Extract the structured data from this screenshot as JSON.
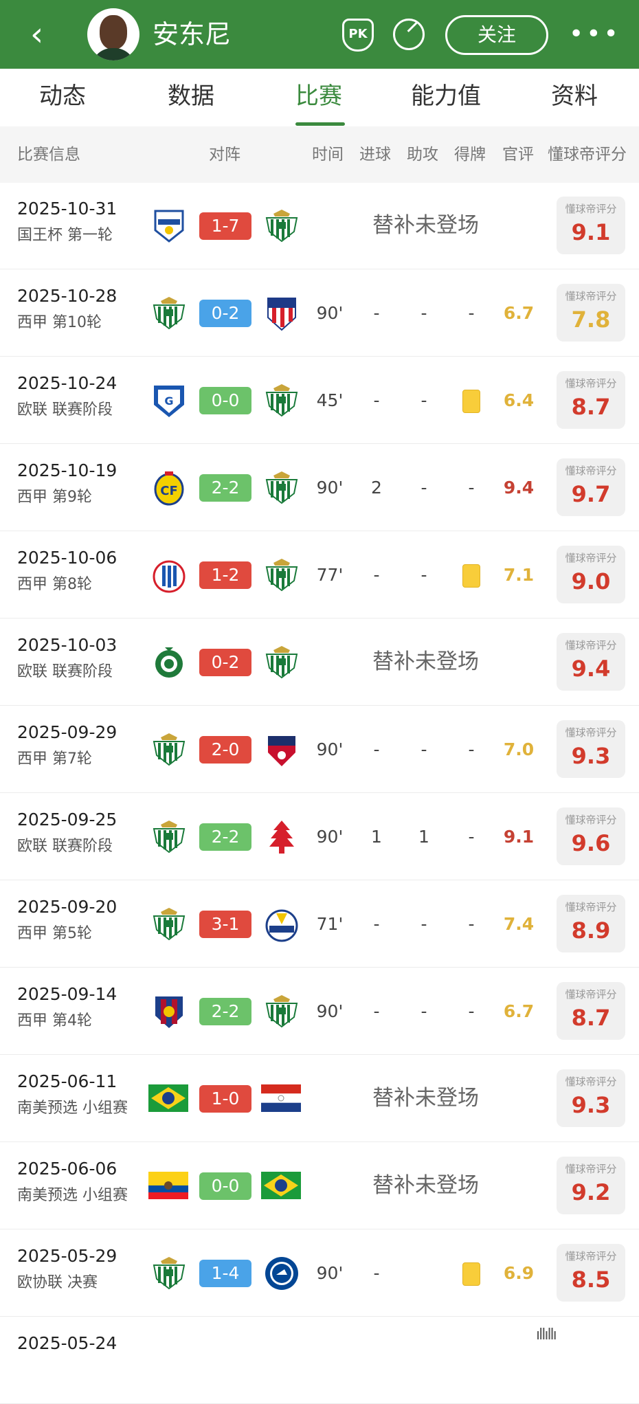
{
  "header": {
    "back_icon": "‹",
    "player_name": "安东尼",
    "pk_label": "PK",
    "follow_label": "关注",
    "more_icon": "•••"
  },
  "tabs": [
    {
      "label": "动态"
    },
    {
      "label": "数据"
    },
    {
      "label": "比赛"
    },
    {
      "label": "能力值"
    },
    {
      "label": "资料"
    }
  ],
  "active_tab": "比赛",
  "columns": {
    "info": "比赛信息",
    "matchup": "对阵",
    "time": "时间",
    "goals": "进球",
    "assists": "助攻",
    "cards": "得牌",
    "official": "官评",
    "dqd": "懂球帝评分"
  },
  "rating_label": "懂球帝评分",
  "colors": {
    "green": "#3b8a3e",
    "score_red": "#e04a3e",
    "score_green": "#6cc26a",
    "score_blue": "#4aa3e8",
    "official_gold": "#e0b23a",
    "official_red": "#c54133",
    "rating_red": "#d23b2c",
    "yellow_card": "#f8cd3a"
  },
  "matches": [
    {
      "date": "2025-10-31",
      "comp": "国王杯 第一轮",
      "home": "constancia-crest",
      "score": "1-7",
      "result": "red",
      "away": "betis-crest",
      "no_play": "替补未登场",
      "time": "",
      "goals": "",
      "assists": "",
      "card": "",
      "official": "",
      "official_color": "",
      "rating": "9.1"
    },
    {
      "date": "2025-10-28",
      "comp": "西甲 第10轮",
      "home": "betis-crest",
      "score": "0-2",
      "result": "blue",
      "away": "atletico-crest",
      "no_play": "",
      "time": "90'",
      "goals": "-",
      "assists": "-",
      "card": "-",
      "official": "6.7",
      "official_color": "gold",
      "rating": "7.8",
      "rating_color": "gold"
    },
    {
      "date": "2025-10-24",
      "comp": "欧联 联赛阶段",
      "home": "genk-crest",
      "score": "0-0",
      "result": "green",
      "away": "betis-crest",
      "no_play": "",
      "time": "45'",
      "goals": "-",
      "assists": "-",
      "card": "yellow",
      "official": "6.4",
      "official_color": "gold",
      "rating": "8.7"
    },
    {
      "date": "2025-10-19",
      "comp": "西甲 第9轮",
      "home": "villarreal-crest",
      "score": "2-2",
      "result": "green",
      "away": "betis-crest",
      "no_play": "",
      "time": "90'",
      "goals": "2",
      "assists": "-",
      "card": "-",
      "official": "9.4",
      "official_color": "red",
      "rating": "9.7"
    },
    {
      "date": "2025-10-06",
      "comp": "西甲 第8轮",
      "home": "espanyol-crest",
      "score": "1-2",
      "result": "red",
      "away": "betis-crest",
      "no_play": "",
      "time": "77'",
      "goals": "-",
      "assists": "-",
      "card": "yellow",
      "official": "7.1",
      "official_color": "gold",
      "rating": "9.0"
    },
    {
      "date": "2025-10-03",
      "comp": "欧联 联赛阶段",
      "home": "ludogorets-crest",
      "score": "0-2",
      "result": "red",
      "away": "betis-crest",
      "no_play": "替补未登场",
      "time": "",
      "goals": "",
      "assists": "",
      "card": "",
      "official": "",
      "official_color": "",
      "rating": "9.4"
    },
    {
      "date": "2025-09-29",
      "comp": "西甲 第7轮",
      "home": "betis-crest",
      "score": "2-0",
      "result": "red",
      "away": "osasuna-crest",
      "no_play": "",
      "time": "90'",
      "goals": "-",
      "assists": "-",
      "card": "-",
      "official": "7.0",
      "official_color": "gold",
      "rating": "9.3"
    },
    {
      "date": "2025-09-25",
      "comp": "欧联 联赛阶段",
      "home": "betis-crest",
      "score": "2-2",
      "result": "green",
      "away": "forest-crest",
      "no_play": "",
      "time": "90'",
      "goals": "1",
      "assists": "1",
      "card": "-",
      "official": "9.1",
      "official_color": "red",
      "rating": "9.6"
    },
    {
      "date": "2025-09-20",
      "comp": "西甲 第5轮",
      "home": "betis-crest",
      "score": "3-1",
      "result": "red",
      "away": "sociedad-crest",
      "no_play": "",
      "time": "71'",
      "goals": "-",
      "assists": "-",
      "card": "-",
      "official": "7.4",
      "official_color": "gold",
      "rating": "8.9"
    },
    {
      "date": "2025-09-14",
      "comp": "西甲 第4轮",
      "home": "levante-crest",
      "score": "2-2",
      "result": "green",
      "away": "betis-crest",
      "no_play": "",
      "time": "90'",
      "goals": "-",
      "assists": "-",
      "card": "-",
      "official": "6.7",
      "official_color": "gold",
      "rating": "8.7"
    },
    {
      "date": "2025-06-11",
      "comp": "南美预选 小组赛",
      "home": "brazil-flag",
      "score": "1-0",
      "result": "red",
      "away": "paraguay-flag",
      "no_play": "替补未登场",
      "time": "",
      "goals": "",
      "assists": "",
      "card": "",
      "official": "",
      "official_color": "",
      "rating": "9.3"
    },
    {
      "date": "2025-06-06",
      "comp": "南美预选 小组赛",
      "home": "ecuador-flag",
      "score": "0-0",
      "result": "green",
      "away": "brazil-flag",
      "no_play": "替补未登场",
      "time": "",
      "goals": "",
      "assists": "",
      "card": "",
      "official": "",
      "official_color": "",
      "rating": "9.2"
    },
    {
      "date": "2025-05-29",
      "comp": "欧协联 决赛",
      "home": "betis-crest",
      "score": "1-4",
      "result": "blue",
      "away": "chelsea-crest",
      "no_play": "",
      "time": "90'",
      "goals": "-",
      "assists": "",
      "card": "yellow",
      "official": "6.9",
      "official_color": "gold",
      "rating": "8.5"
    },
    {
      "date": "2025-05-24",
      "comp": "",
      "home": "",
      "score": "",
      "result": "",
      "away": "",
      "no_play": "",
      "time": "",
      "goals": "",
      "assists": "",
      "card": "",
      "official": "",
      "official_color": "",
      "rating": ""
    }
  ],
  "watermark": "ıllıllı"
}
